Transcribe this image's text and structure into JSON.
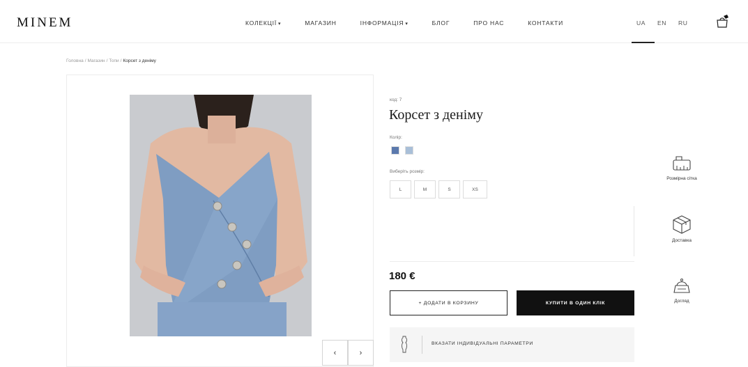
{
  "header": {
    "logo": "MINEM",
    "nav": [
      {
        "label": "КОЛЕКЦІЇ",
        "has_caret": true
      },
      {
        "label": "МАГАЗИН",
        "has_caret": false
      },
      {
        "label": "ІНФОРМАЦІЯ",
        "has_caret": true
      },
      {
        "label": "БЛОГ",
        "has_caret": false
      },
      {
        "label": "ПРО НАС",
        "has_caret": false
      },
      {
        "label": "КОНТАКТИ",
        "has_caret": false
      }
    ],
    "caret": "▾",
    "languages": [
      "UA",
      "EN",
      "RU"
    ],
    "active_language": "UA",
    "cart_icon": "shopping-bag-icon"
  },
  "breadcrumb": {
    "items": [
      "Головна",
      "Магазин",
      "Топи"
    ],
    "separator": "/",
    "current": "Корсет з деніму"
  },
  "gallery": {
    "prev_label": "‹",
    "next_label": "›"
  },
  "product": {
    "sku": "код: 7",
    "title": "Корсет з деніму",
    "color_label": "Колір:",
    "colors": [
      "#5b79ad",
      "#a9bfd8"
    ],
    "size_label": "Виберіть розмір:",
    "sizes": [
      "L",
      "M",
      "S",
      "XS"
    ],
    "price": "180 €",
    "add_to_cart": "+ додати в корзину",
    "buy_one_click": "купити в один клік",
    "individual_params": "вказати індивідуальні параметри"
  },
  "features": [
    {
      "label": "Розмірна сітка",
      "icon": "size-chart-icon"
    },
    {
      "label": "Доставка",
      "icon": "delivery-box-icon"
    },
    {
      "label": "Догляд",
      "icon": "care-icon"
    }
  ],
  "colors": {
    "primary_text": "#111111",
    "button_dark": "#111111",
    "photo_bg": "#c7c9cd",
    "denim": "#7f9dc2"
  }
}
